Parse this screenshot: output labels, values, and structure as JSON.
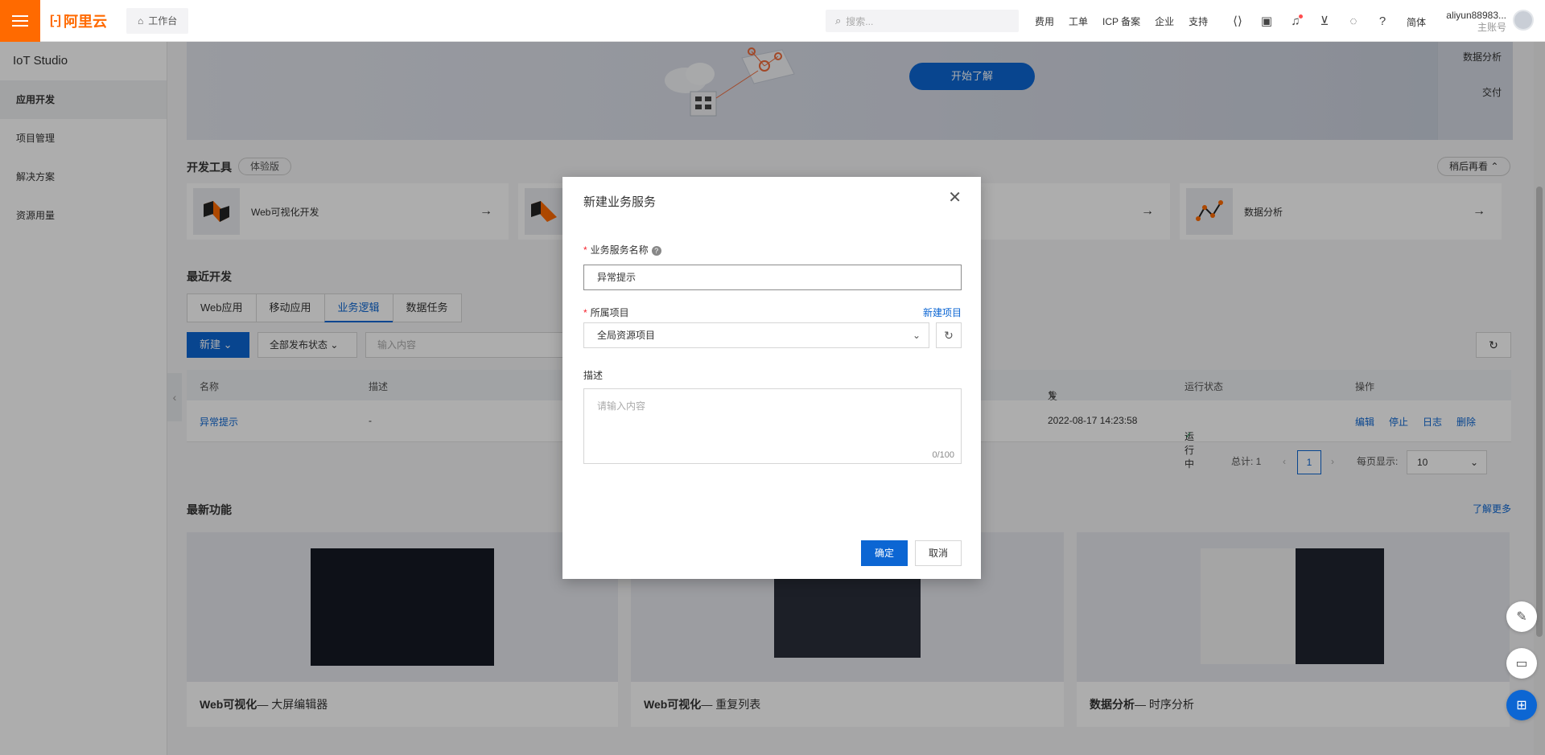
{
  "topbar": {
    "logo_text": "阿里云",
    "workbench_label": "工作台",
    "search_placeholder": "搜索...",
    "links": [
      "费用",
      "工单",
      "ICP 备案",
      "企业",
      "支持"
    ],
    "lang": "简体",
    "account_name": "aliyun88983...",
    "account_role": "主账号",
    "brand_color": "#ff6a00"
  },
  "sidebar": {
    "title": "IoT Studio",
    "items": [
      "应用开发",
      "项目管理",
      "解决方案",
      "资源用量"
    ]
  },
  "banner": {
    "button_label": "开始了解",
    "right_items": [
      "数据分析",
      "交付"
    ]
  },
  "dev_tools": {
    "title": "开发工具",
    "badge": "体验版",
    "later_label": "稍后再看",
    "cards": [
      "Web可视化开发",
      "数据分析"
    ]
  },
  "recent": {
    "title": "最近开发",
    "tabs": [
      "Web应用",
      "移动应用",
      "业务逻辑",
      "数据任务"
    ],
    "new_label": "新建",
    "status_filter": "全部发布状态",
    "search_placeholder": "输入内容",
    "columns": [
      "名称",
      "描述",
      "发布时间",
      "运行状态",
      "操作"
    ],
    "rows": [
      {
        "name": "异常提示",
        "desc": "-",
        "time": "2022-08-17 14:23:58",
        "status": "运行中",
        "actions": [
          "编辑",
          "停止",
          "日志",
          "删除"
        ]
      }
    ],
    "total": "总计: 1",
    "page": "1",
    "per_page_label": "每页显示:",
    "per_page": "10"
  },
  "features": {
    "title": "最新功能",
    "more": "了解更多",
    "cards": [
      {
        "main": "Web可视化",
        "sub": "— 大屏编辑器"
      },
      {
        "main": "Web可视化",
        "sub": "— 重复列表"
      },
      {
        "main": "数据分析",
        "sub": "— 时序分析"
      }
    ]
  },
  "modal": {
    "title": "新建业务服务",
    "name_label": "业务服务名称",
    "name_value": "异常提示",
    "project_label": "所属项目",
    "new_project": "新建项目",
    "project_value": "全局资源项目",
    "desc_label": "描述",
    "desc_placeholder": "请输入内容",
    "desc_count": "0/100",
    "ok_label": "确定",
    "cancel_label": "取消",
    "accent_color": "#0c66d3"
  }
}
